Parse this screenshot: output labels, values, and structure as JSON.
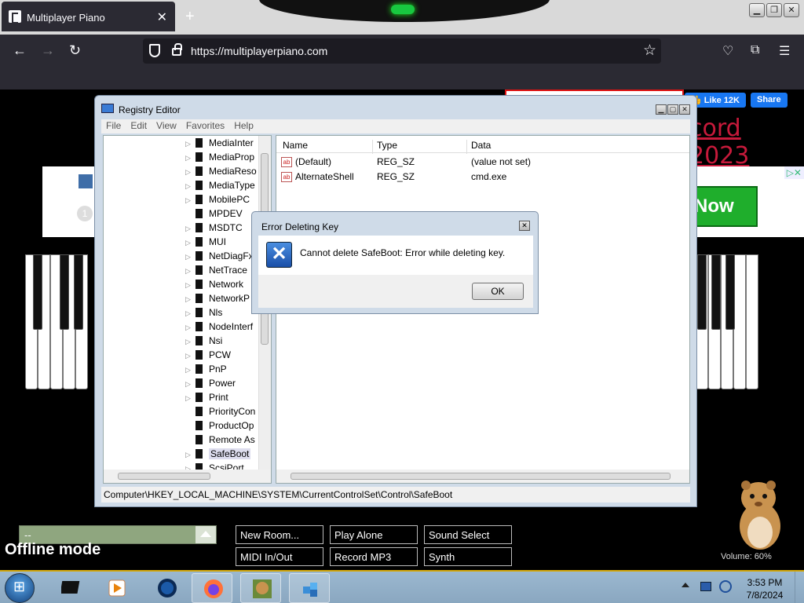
{
  "browser": {
    "tab_title": "Multiplayer Piano",
    "url": "https://multiplayerpiano.com",
    "new_tab": "+",
    "close_tab": "✕"
  },
  "page": {
    "fb_like": "👍 Like 12K",
    "fb_share": "Share",
    "record_text": "cord 2023",
    "ad_number": "1",
    "ad_button": "Now",
    "ad_close": "▷✕",
    "select_value": "--",
    "offline_mode": "Offline mode",
    "buttons": [
      "New Room...",
      "Play Alone",
      "Sound Select",
      "MIDI In/Out",
      "Record MP3",
      "Synth"
    ],
    "volume": "Volume: 60%"
  },
  "regedit": {
    "title": "Registry Editor",
    "menu": [
      "File",
      "Edit",
      "View",
      "Favorites",
      "Help"
    ],
    "tree_items": [
      {
        "label": "MediaInter",
        "expandable": true
      },
      {
        "label": "MediaProp",
        "expandable": true
      },
      {
        "label": "MediaReso",
        "expandable": true
      },
      {
        "label": "MediaType",
        "expandable": true
      },
      {
        "label": "MobilePC",
        "expandable": true
      },
      {
        "label": "MPDEV",
        "expandable": false
      },
      {
        "label": "MSDTC",
        "expandable": true
      },
      {
        "label": "MUI",
        "expandable": true
      },
      {
        "label": "NetDiagFx",
        "expandable": true
      },
      {
        "label": "NetTrace",
        "expandable": true
      },
      {
        "label": "Network",
        "expandable": true
      },
      {
        "label": "NetworkP",
        "expandable": true
      },
      {
        "label": "Nls",
        "expandable": true
      },
      {
        "label": "NodeInterf",
        "expandable": true
      },
      {
        "label": "Nsi",
        "expandable": true
      },
      {
        "label": "PCW",
        "expandable": true
      },
      {
        "label": "PnP",
        "expandable": true
      },
      {
        "label": "Power",
        "expandable": true
      },
      {
        "label": "Print",
        "expandable": true
      },
      {
        "label": "PriorityCon",
        "expandable": false
      },
      {
        "label": "ProductOp",
        "expandable": false
      },
      {
        "label": "Remote As",
        "expandable": false
      },
      {
        "label": "SafeBoot",
        "expandable": true,
        "selected": true
      },
      {
        "label": "ScsiPort",
        "expandable": true
      }
    ],
    "columns": [
      "Name",
      "Type",
      "Data"
    ],
    "rows": [
      {
        "name": "(Default)",
        "type": "REG_SZ",
        "data": "(value not set)"
      },
      {
        "name": "AlternateShell",
        "type": "REG_SZ",
        "data": "cmd.exe"
      }
    ],
    "status_path": "Computer\\HKEY_LOCAL_MACHINE\\SYSTEM\\CurrentControlSet\\Control\\SafeBoot"
  },
  "dialog": {
    "title": "Error Deleting Key",
    "message": "Cannot delete SafeBoot:  Error while deleting key.",
    "ok": "OK",
    "icon": "error-x-icon"
  },
  "taskbar": {
    "time": "3:53 PM",
    "date": "7/8/2024"
  }
}
